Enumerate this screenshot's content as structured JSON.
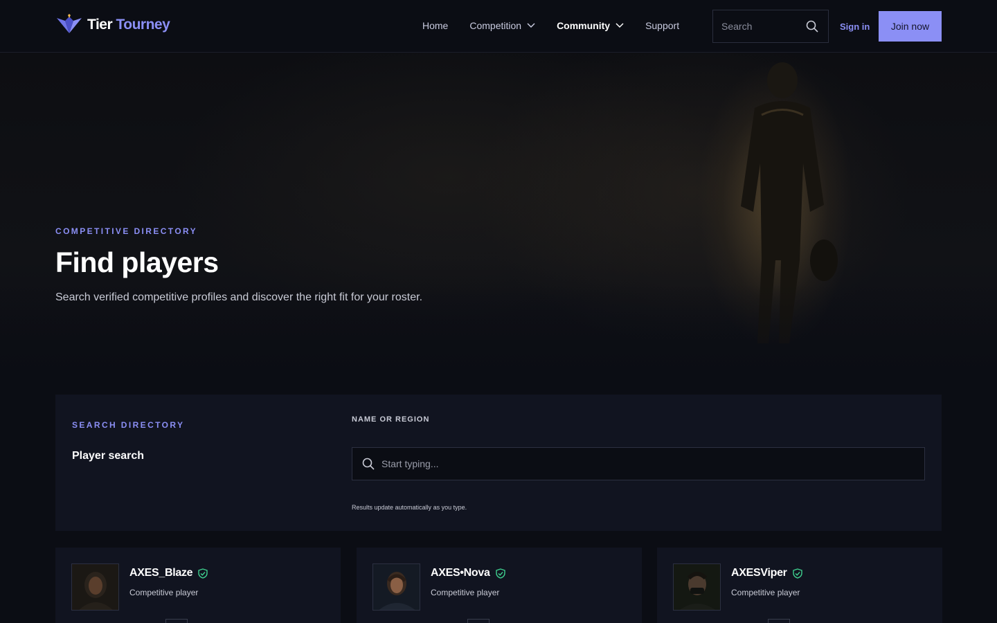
{
  "brand": {
    "name_part1": "Tier",
    "name_part2": "Tourney"
  },
  "nav": {
    "links": [
      {
        "label": "Home"
      },
      {
        "label": "Competition"
      },
      {
        "label": "Community"
      },
      {
        "label": "Support"
      }
    ],
    "search_placeholder": "Search",
    "signin_label": "Sign in",
    "join_label": "Join now"
  },
  "hero": {
    "eyebrow": "COMPETITIVE DIRECTORY",
    "title": "Find players",
    "subtitle": "Search verified competitive profiles and discover the right fit for your roster."
  },
  "search_panel": {
    "eyebrow": "SEARCH DIRECTORY",
    "title": "Player search",
    "field_label": "NAME OR REGION",
    "placeholder": "Start typing...",
    "hint": "Results update automatically as you type."
  },
  "players": [
    {
      "name": "AXES_Blaze",
      "role": "Competitive player"
    },
    {
      "name": "AXES•Nova",
      "role": "Competitive player"
    },
    {
      "name": "AXESViper",
      "role": "Competitive player"
    }
  ],
  "colors": {
    "accent": "#8b8ff5",
    "verified": "#3ecf8e",
    "background": "#0b0d14",
    "panel": "#111420"
  },
  "icons": [
    "logo-icon",
    "chevron-down-icon",
    "search-icon",
    "verified-shield-icon"
  ]
}
